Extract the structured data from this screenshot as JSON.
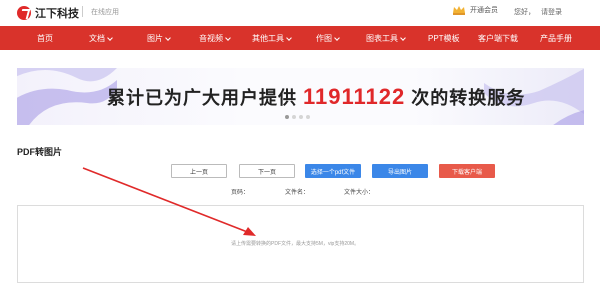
{
  "header": {
    "brand": "江下科技",
    "online_label": "在线应用",
    "vip_label": "开通会员",
    "greeting": "您好，",
    "login_label": "请登录"
  },
  "nav": {
    "items": [
      {
        "label": "首页"
      },
      {
        "label": "文档"
      },
      {
        "label": "图片"
      },
      {
        "label": "音视频"
      },
      {
        "label": "其他工具"
      },
      {
        "label": "作图"
      },
      {
        "label": "图表工具"
      },
      {
        "label": "PPT模板"
      },
      {
        "label": "客户端下载"
      },
      {
        "label": "产品手册"
      }
    ]
  },
  "banner": {
    "prefix": "累计已为广大用户提供",
    "count": "11911122",
    "suffix": "次的转换服务",
    "slide_index": 1,
    "slide_total": 4
  },
  "tool": {
    "title": "PDF转图片",
    "buttons": {
      "prev": "上一页",
      "next": "下一页",
      "choose": "选择一个pdf文件",
      "export": "导出图片",
      "download": "下载客户端"
    },
    "meta": {
      "page": "页码：",
      "filename": "文件名：",
      "filesize": "文件大小："
    },
    "upload_hint": "请上传需要转换的PDF文件，最大支持5M，vip支持20M。"
  },
  "colors": {
    "nav_bg": "#d9332b",
    "brand_red": "#e0282a",
    "blue": "#3b87e8",
    "button_red": "#e85a4a",
    "arrow": "#e02a2a"
  }
}
